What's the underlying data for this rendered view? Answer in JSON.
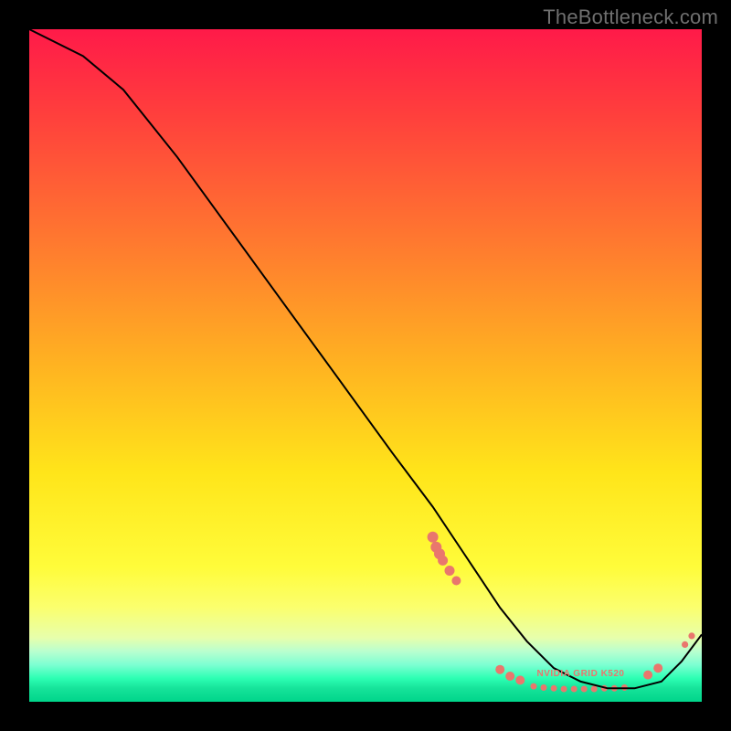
{
  "watermark": {
    "text": "TheBottleneck.com"
  },
  "chart_data": {
    "type": "line",
    "title": "",
    "xlabel": "",
    "ylabel": "",
    "xlim": [
      0,
      100
    ],
    "ylim": [
      0,
      100
    ],
    "grid": false,
    "series": [
      {
        "name": "curve",
        "x": [
          0,
          8,
          14,
          22,
          30,
          38,
          46,
          54,
          60,
          66,
          70,
          74,
          78,
          82,
          86,
          90,
          94,
          97,
          100
        ],
        "y": [
          100,
          96,
          91,
          81,
          70,
          59,
          48,
          37,
          29,
          20,
          14,
          9,
          5,
          3,
          2,
          2,
          3,
          6,
          10
        ],
        "stroke": "#000000",
        "stroke_width": 2
      }
    ],
    "markers": [
      {
        "shape": "circle",
        "x": 60.0,
        "y": 24.5,
        "r": 6,
        "fill": "#e9776d"
      },
      {
        "shape": "circle",
        "x": 60.5,
        "y": 23.0,
        "r": 6,
        "fill": "#e9776d"
      },
      {
        "shape": "circle",
        "x": 61.0,
        "y": 22.0,
        "r": 6,
        "fill": "#e9776d"
      },
      {
        "shape": "circle",
        "x": 61.5,
        "y": 21.0,
        "r": 5.5,
        "fill": "#e9776d"
      },
      {
        "shape": "circle",
        "x": 62.5,
        "y": 19.5,
        "r": 5.5,
        "fill": "#e9776d"
      },
      {
        "shape": "circle",
        "x": 63.5,
        "y": 18.0,
        "r": 5,
        "fill": "#e9776d"
      },
      {
        "shape": "circle",
        "x": 70.0,
        "y": 4.8,
        "r": 5,
        "fill": "#e9776d"
      },
      {
        "shape": "circle",
        "x": 71.5,
        "y": 3.8,
        "r": 5,
        "fill": "#e9776d"
      },
      {
        "shape": "circle",
        "x": 73.0,
        "y": 3.2,
        "r": 5,
        "fill": "#e9776d"
      },
      {
        "shape": "circle",
        "x": 75.0,
        "y": 2.3,
        "r": 3.5,
        "fill": "#e9776d"
      },
      {
        "shape": "circle",
        "x": 76.5,
        "y": 2.1,
        "r": 3.5,
        "fill": "#e9776d"
      },
      {
        "shape": "circle",
        "x": 78.0,
        "y": 2.0,
        "r": 3.5,
        "fill": "#e9776d"
      },
      {
        "shape": "circle",
        "x": 79.5,
        "y": 1.9,
        "r": 3.5,
        "fill": "#e9776d"
      },
      {
        "shape": "circle",
        "x": 81.0,
        "y": 1.9,
        "r": 3.5,
        "fill": "#e9776d"
      },
      {
        "shape": "circle",
        "x": 82.5,
        "y": 1.9,
        "r": 3.5,
        "fill": "#e9776d"
      },
      {
        "shape": "circle",
        "x": 84.0,
        "y": 1.9,
        "r": 3.5,
        "fill": "#e9776d"
      },
      {
        "shape": "circle",
        "x": 85.5,
        "y": 2.0,
        "r": 3.5,
        "fill": "#e9776d"
      },
      {
        "shape": "circle",
        "x": 87.0,
        "y": 2.0,
        "r": 3.5,
        "fill": "#e9776d"
      },
      {
        "shape": "circle",
        "x": 88.5,
        "y": 2.1,
        "r": 3.5,
        "fill": "#e9776d"
      },
      {
        "shape": "circle",
        "x": 92.0,
        "y": 4.0,
        "r": 5,
        "fill": "#e9776d"
      },
      {
        "shape": "circle",
        "x": 93.5,
        "y": 5.0,
        "r": 5,
        "fill": "#e9776d"
      },
      {
        "shape": "circle",
        "x": 97.5,
        "y": 8.5,
        "r": 3.6,
        "fill": "#e9776d"
      },
      {
        "shape": "circle",
        "x": 98.5,
        "y": 9.8,
        "r": 3.6,
        "fill": "#e9776d"
      }
    ],
    "dash_label": {
      "text": "NVIDIA GRID K520",
      "x": 82,
      "y": 3.8
    }
  }
}
